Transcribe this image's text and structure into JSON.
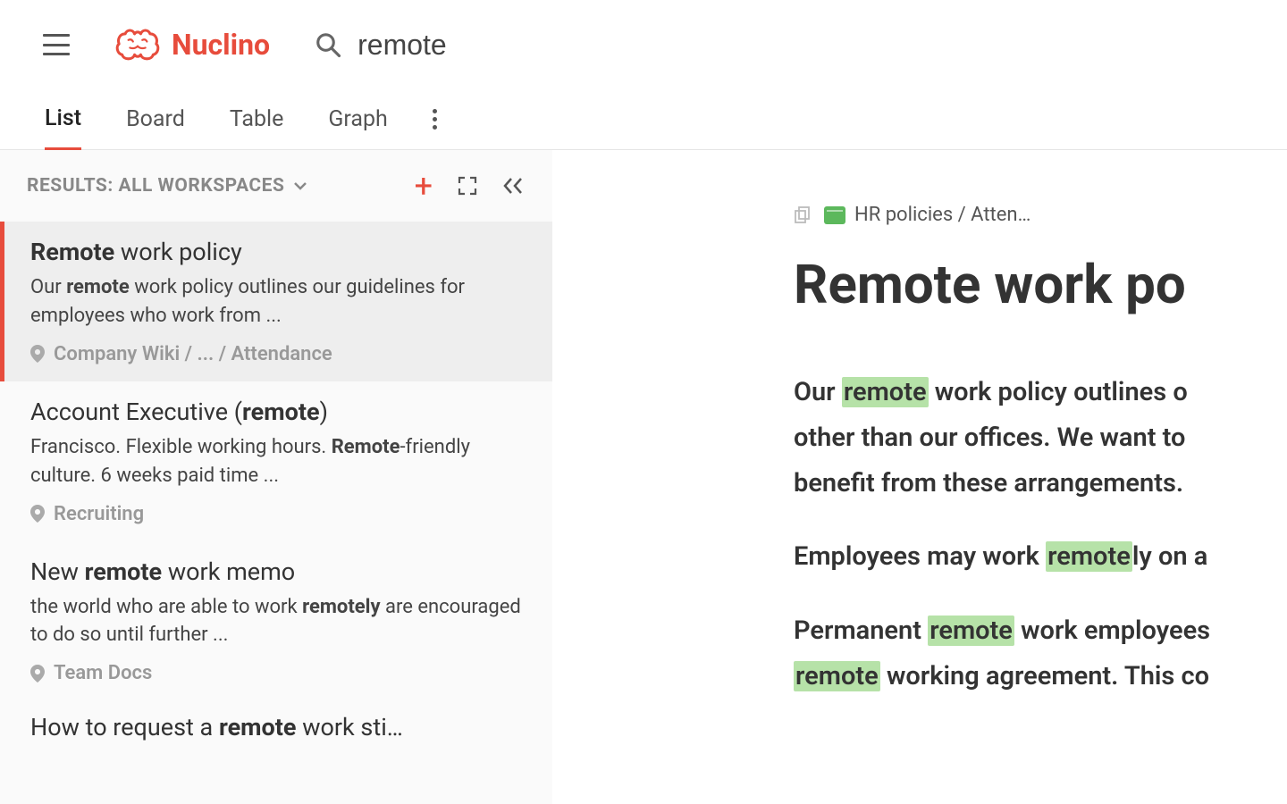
{
  "brand": "Nuclino",
  "search": {
    "query": "remote"
  },
  "tabs": [
    "List",
    "Board",
    "Table",
    "Graph"
  ],
  "activeTab": 0,
  "resultsHeader": "RESULTS: ALL WORKSPACES",
  "results": [
    {
      "title": "<b>Remote</b> work policy",
      "snippet": "Our <b>remote</b> work policy outlines our guidelines for employees who work from ...",
      "path": "Company Wiki / ... / Attendance",
      "selected": true
    },
    {
      "title": "Account Executive (<b>remote</b>)",
      "snippet": "Francisco. Flexible working hours. <b>Remote</b>-friendly culture. 6 weeks paid time ...",
      "path": "Recruiting",
      "selected": false
    },
    {
      "title": "New <b>remote</b> work memo",
      "snippet": "the world who are able to work <b>remotely</b> are encouraged to do so until further ...",
      "path": "Team Docs",
      "selected": false
    },
    {
      "title": "How to request a <b>remote</b> work sti…",
      "snippet": "",
      "path": "",
      "selected": false
    }
  ],
  "doc": {
    "breadcrumb": "HR policies / Atten…",
    "title": "Remote work po",
    "para1_pre": "Our ",
    "para1_hl1": "remote",
    "para1_mid": " work policy outlines o",
    "para1_line2": "other than our offices. We want to ",
    "para1_line3": "benefit from these arrangements.",
    "para2_pre": "Employees may work ",
    "para2_hl": "remote",
    "para2_post": "ly on a",
    "para3_pre": "Permanent ",
    "para3_hl1": "remote",
    "para3_mid": " work employees",
    "para3_hl2": "remote",
    "para3_post": " working agreement. This co"
  }
}
